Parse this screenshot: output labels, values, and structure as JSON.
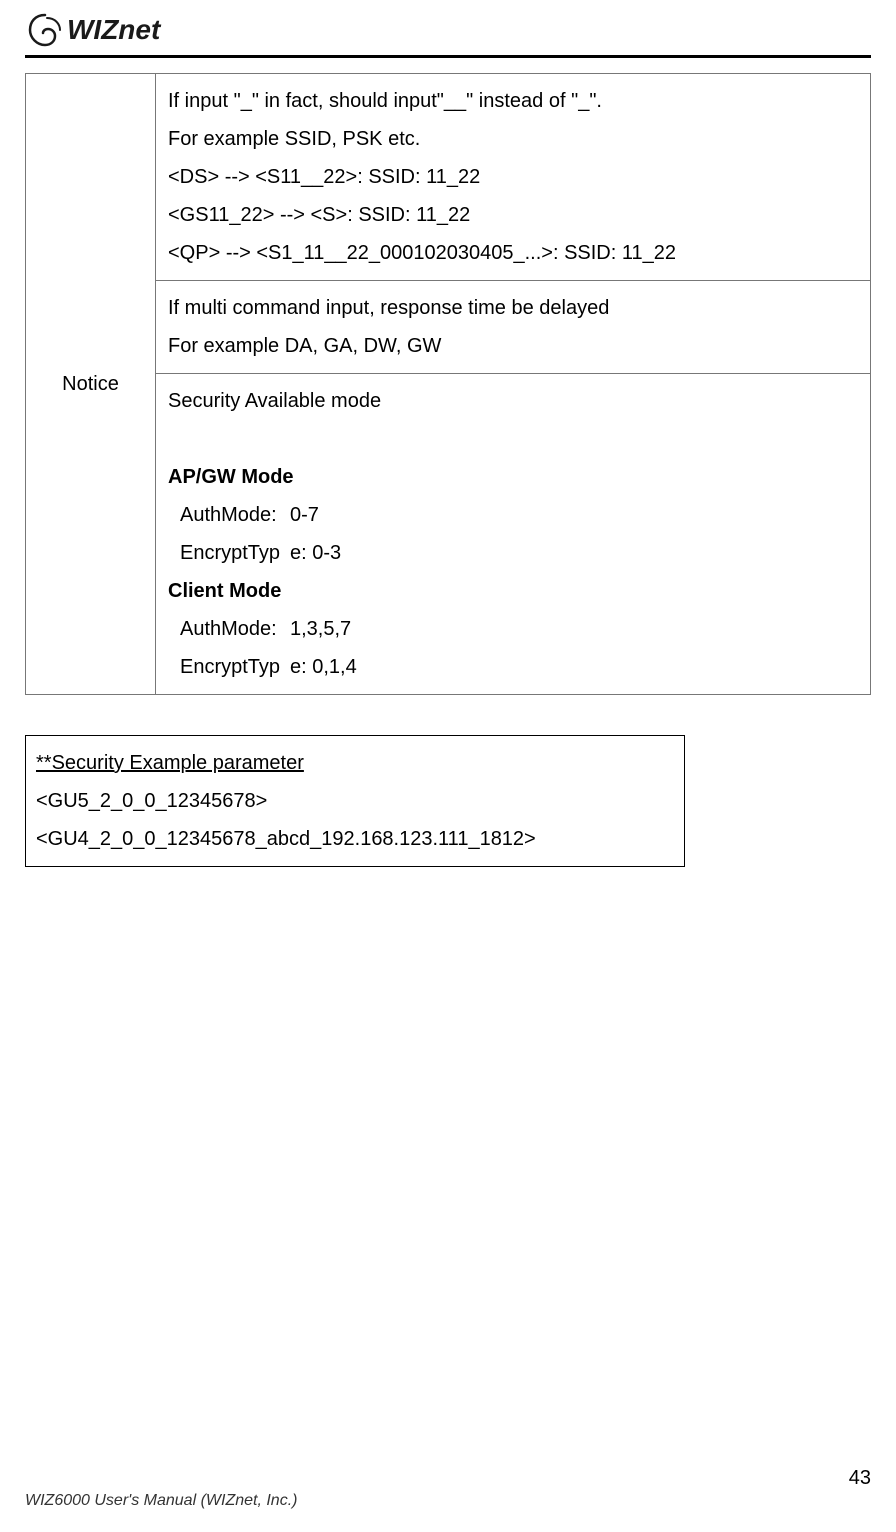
{
  "logo_text": "WIZnet",
  "notice_label": "Notice",
  "cell1": {
    "l1": "If input \"_\" in fact, should input\"__\" instead of \"_\".",
    "l2": "For example SSID, PSK etc.",
    "l3": "<DS> --> <S11__22>: SSID: 11_22",
    "l4": "<GS11_22> --> <S>: SSID: 11_22",
    "l5": "<QP> --> <S1_11__22_000102030405_...>: SSID: 11_22"
  },
  "cell2": {
    "l1": "If multi command input, response time be delayed",
    "l2": "For example DA, GA, DW, GW"
  },
  "cell3": {
    "title": "Security Available mode",
    "mode1": "AP/GW Mode",
    "mode1_auth_l": "AuthMode:",
    "mode1_auth_v": "0-7",
    "mode1_enc_l": "EncryptTyp",
    "mode1_enc_v": "e: 0-3",
    "mode2": "Client Mode",
    "mode2_auth_l": "AuthMode:",
    "mode2_auth_v": "1,3,5,7",
    "mode2_enc_l": "EncryptTyp",
    "mode2_enc_v": "e: 0,1,4"
  },
  "example": {
    "title": "**Security Example parameter",
    "l1": "<GU5_2_0_0_12345678>",
    "l2": "<GU4_2_0_0_12345678_abcd_192.168.123.111_1812>"
  },
  "footer": {
    "manual": "WIZ6000 User's Manual ",
    "company": "(WIZnet, Inc.)",
    "page": "43"
  }
}
